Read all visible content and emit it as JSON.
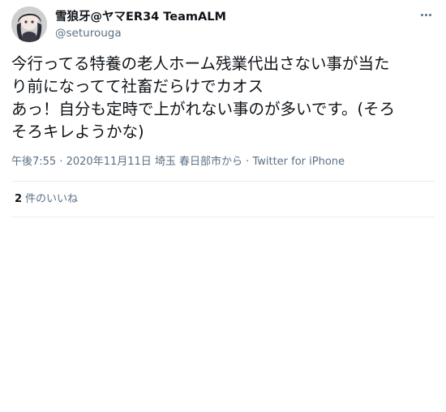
{
  "author": {
    "display_name": "雪狼牙@ヤマER34 TeamALM",
    "username": "@seturouga"
  },
  "tweet": {
    "lines": [
      "今行ってる特養の老人ホーム残業代出さない事が当た",
      "り前になってて社畜だらけでカオス",
      "あっ！自分も定時で上がれない事のが多いです。(そろ",
      "そろキレようかな)"
    ]
  },
  "meta": {
    "time": "午後7:55",
    "separator1": " · ",
    "date": "2020年11月11日",
    "location": " 埼玉 春日部市から",
    "separator2": " · ",
    "client": "Twitter for iPhone"
  },
  "stats": {
    "likes_count": "2",
    "likes_label": "件のいいね"
  },
  "icons": {
    "more": "more-horizontal-icon"
  }
}
